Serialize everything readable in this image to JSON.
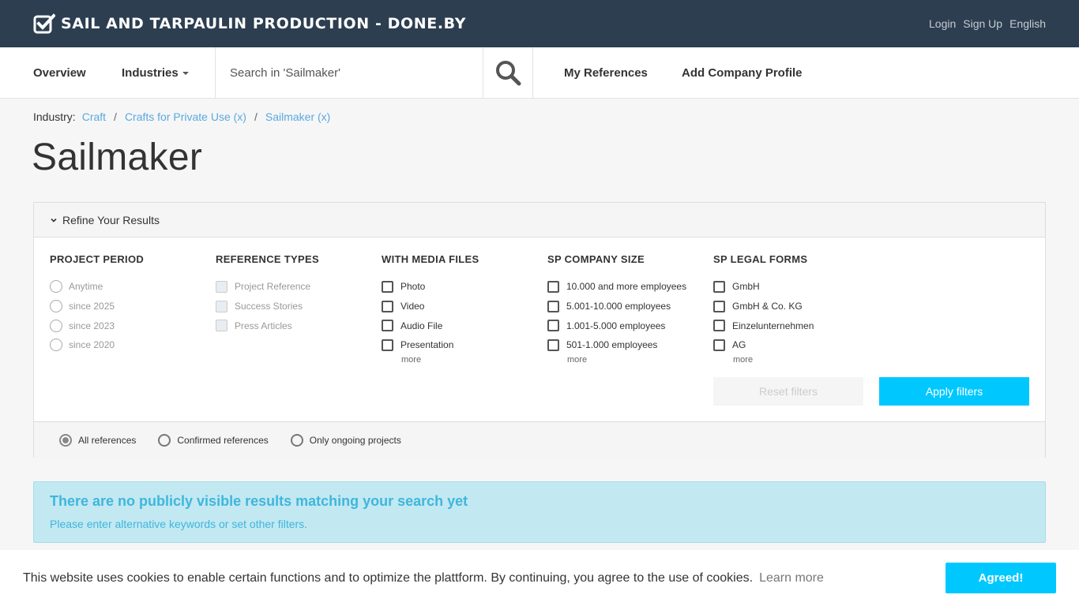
{
  "header": {
    "site_title": "SAIL AND TARPAULIN PRODUCTION - DONE.BY",
    "links": [
      "Login",
      "Sign Up",
      "English"
    ]
  },
  "nav": {
    "overview": "Overview",
    "industries": "Industries",
    "search_placeholder": "Search in 'Sailmaker'",
    "my_references": "My References",
    "add_company_profile": "Add Company Profile"
  },
  "breadcrumb": {
    "label": "Industry:",
    "items": [
      "Craft",
      "Crafts for Private Use (x)",
      "Sailmaker (x)"
    ],
    "separator": "/"
  },
  "page_title": "Sailmaker",
  "filters": {
    "heading": "Refine Your Results",
    "project_period": {
      "title": "PROJECT PERIOD",
      "options": [
        "Anytime",
        "since 2025",
        "since 2023",
        "since 2020"
      ]
    },
    "reference_types": {
      "title": "REFERENCE TYPES",
      "options": [
        "Project Reference",
        "Success Stories",
        "Press Articles"
      ]
    },
    "media_files": {
      "title": "WITH MEDIA FILES",
      "options": [
        "Photo",
        "Video",
        "Audio File",
        "Presentation"
      ],
      "more": "more"
    },
    "company_size": {
      "title": "SP COMPANY SIZE",
      "options": [
        "10.000 and more employees",
        "5.001-10.000 employees",
        "1.001-5.000 employees",
        "501-1.000 employees"
      ],
      "more": "more"
    },
    "legal_forms": {
      "title": "SP LEGAL FORMS",
      "options": [
        "GmbH",
        "GmbH & Co. KG",
        "Einzelunternehmen",
        "AG"
      ],
      "more": "more"
    },
    "reset_label": "Reset filters",
    "apply_label": "Apply filters",
    "scope": {
      "options": [
        "All references",
        "Confirmed references",
        "Only ongoing projects"
      ],
      "selected": "All references"
    }
  },
  "alert": {
    "title": "There are no publicly visible results matching your search yet",
    "text": "Please enter alternative keywords or set other filters."
  },
  "cookie": {
    "text": "This website uses cookies to enable certain functions and to optimize the plattform. By continuing, you agree to the use of cookies.",
    "learn_more": "Learn more",
    "accept": "Agreed!"
  },
  "colors": {
    "topbar": "#2c3e50",
    "accent": "#00c8ff",
    "link": "#5aa8e0",
    "alert_bg": "#c2e8f2"
  }
}
